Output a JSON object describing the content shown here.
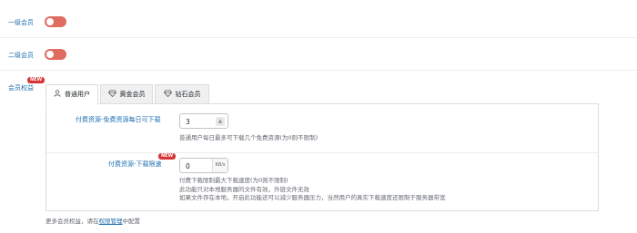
{
  "settings": {
    "level1": {
      "label": "一级会员",
      "enabled": false
    },
    "level2": {
      "label": "二级会员",
      "enabled": false
    },
    "member_rights": {
      "label": "会员权益",
      "badge": "NEW"
    }
  },
  "tabs": [
    {
      "label": "普通用户",
      "icon": "user-icon",
      "active": true
    },
    {
      "label": "黄金会员",
      "icon": "diamond-icon",
      "active": false
    },
    {
      "label": "钻石会员",
      "icon": "diamond-icon",
      "active": false
    }
  ],
  "fields": {
    "free_downloads": {
      "label": "付费资源-免费资源每日可下载",
      "value": "3",
      "description": "普通用户每日最多可下载几个免费资源(为0则不限制)"
    },
    "download_speed": {
      "label": "付费资源-下载限速",
      "badge": "NEW",
      "value": "0",
      "unit": "KB/s",
      "description_lines": [
        "付费下载限制最大下载速度(为0则不限制)",
        "此功能只对本地服务器的文件有效，外链文件无效",
        "如果文件存在本地，开启此功能还可以减少服务器压力，当然用户的真实下载速度还限制于服务器带宽"
      ]
    }
  },
  "footer": {
    "prefix": "更多会员权益，请在",
    "link": "权限管理",
    "suffix": "中配置"
  },
  "colors": {
    "accent": "#2271b1",
    "toggle_off": "#e06b60",
    "badge": "#d63638"
  }
}
